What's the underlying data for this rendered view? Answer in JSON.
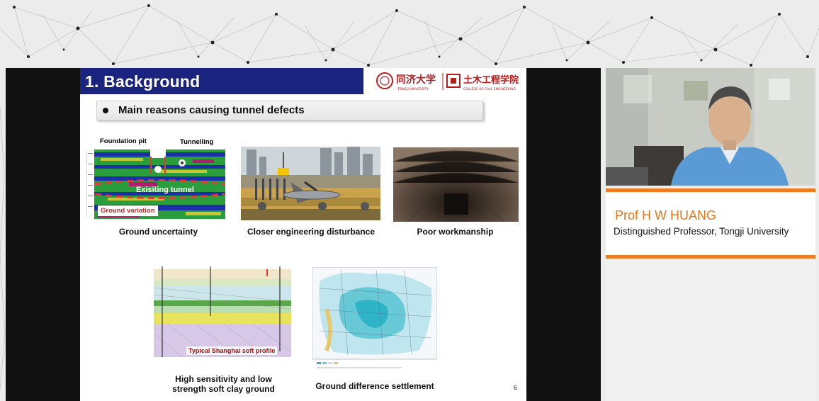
{
  "slide": {
    "title": "1. Background",
    "bullet": "Main reasons causing tunnel defects",
    "page_number": "6",
    "logos": {
      "university_cn": "同济大学",
      "university_en": "TONGJI UNIVERSITY",
      "college_cn": "土木工程学院",
      "college_en": "COLLEGE OF CIVIL ENGINEERING"
    },
    "figures": {
      "ground_uncertainty": {
        "caption": "Ground uncertainty",
        "labels": {
          "foundation_pit": "Foundation pit",
          "tunnelling": "Tunnelling",
          "existing_tunnel": "Exisiting tunnel",
          "ground_variation": "Ground variation"
        }
      },
      "engineering_disturbance": {
        "caption": "Closer engineering disturbance"
      },
      "workmanship": {
        "caption": "Poor workmanship"
      },
      "soft_clay": {
        "caption_line1": "High sensitivity and low",
        "caption_line2": "strength soft clay ground",
        "tag": "Typical Shanghai soft profile"
      },
      "settlement": {
        "caption": "Ground difference settlement"
      }
    }
  },
  "speaker": {
    "name": "Prof H W HUANG",
    "title": "Distinguished Professor, Tongji University"
  },
  "colors": {
    "title_bar": "#1a237e",
    "accent": "#ef7d22",
    "logo_red": "#b71c1c"
  }
}
